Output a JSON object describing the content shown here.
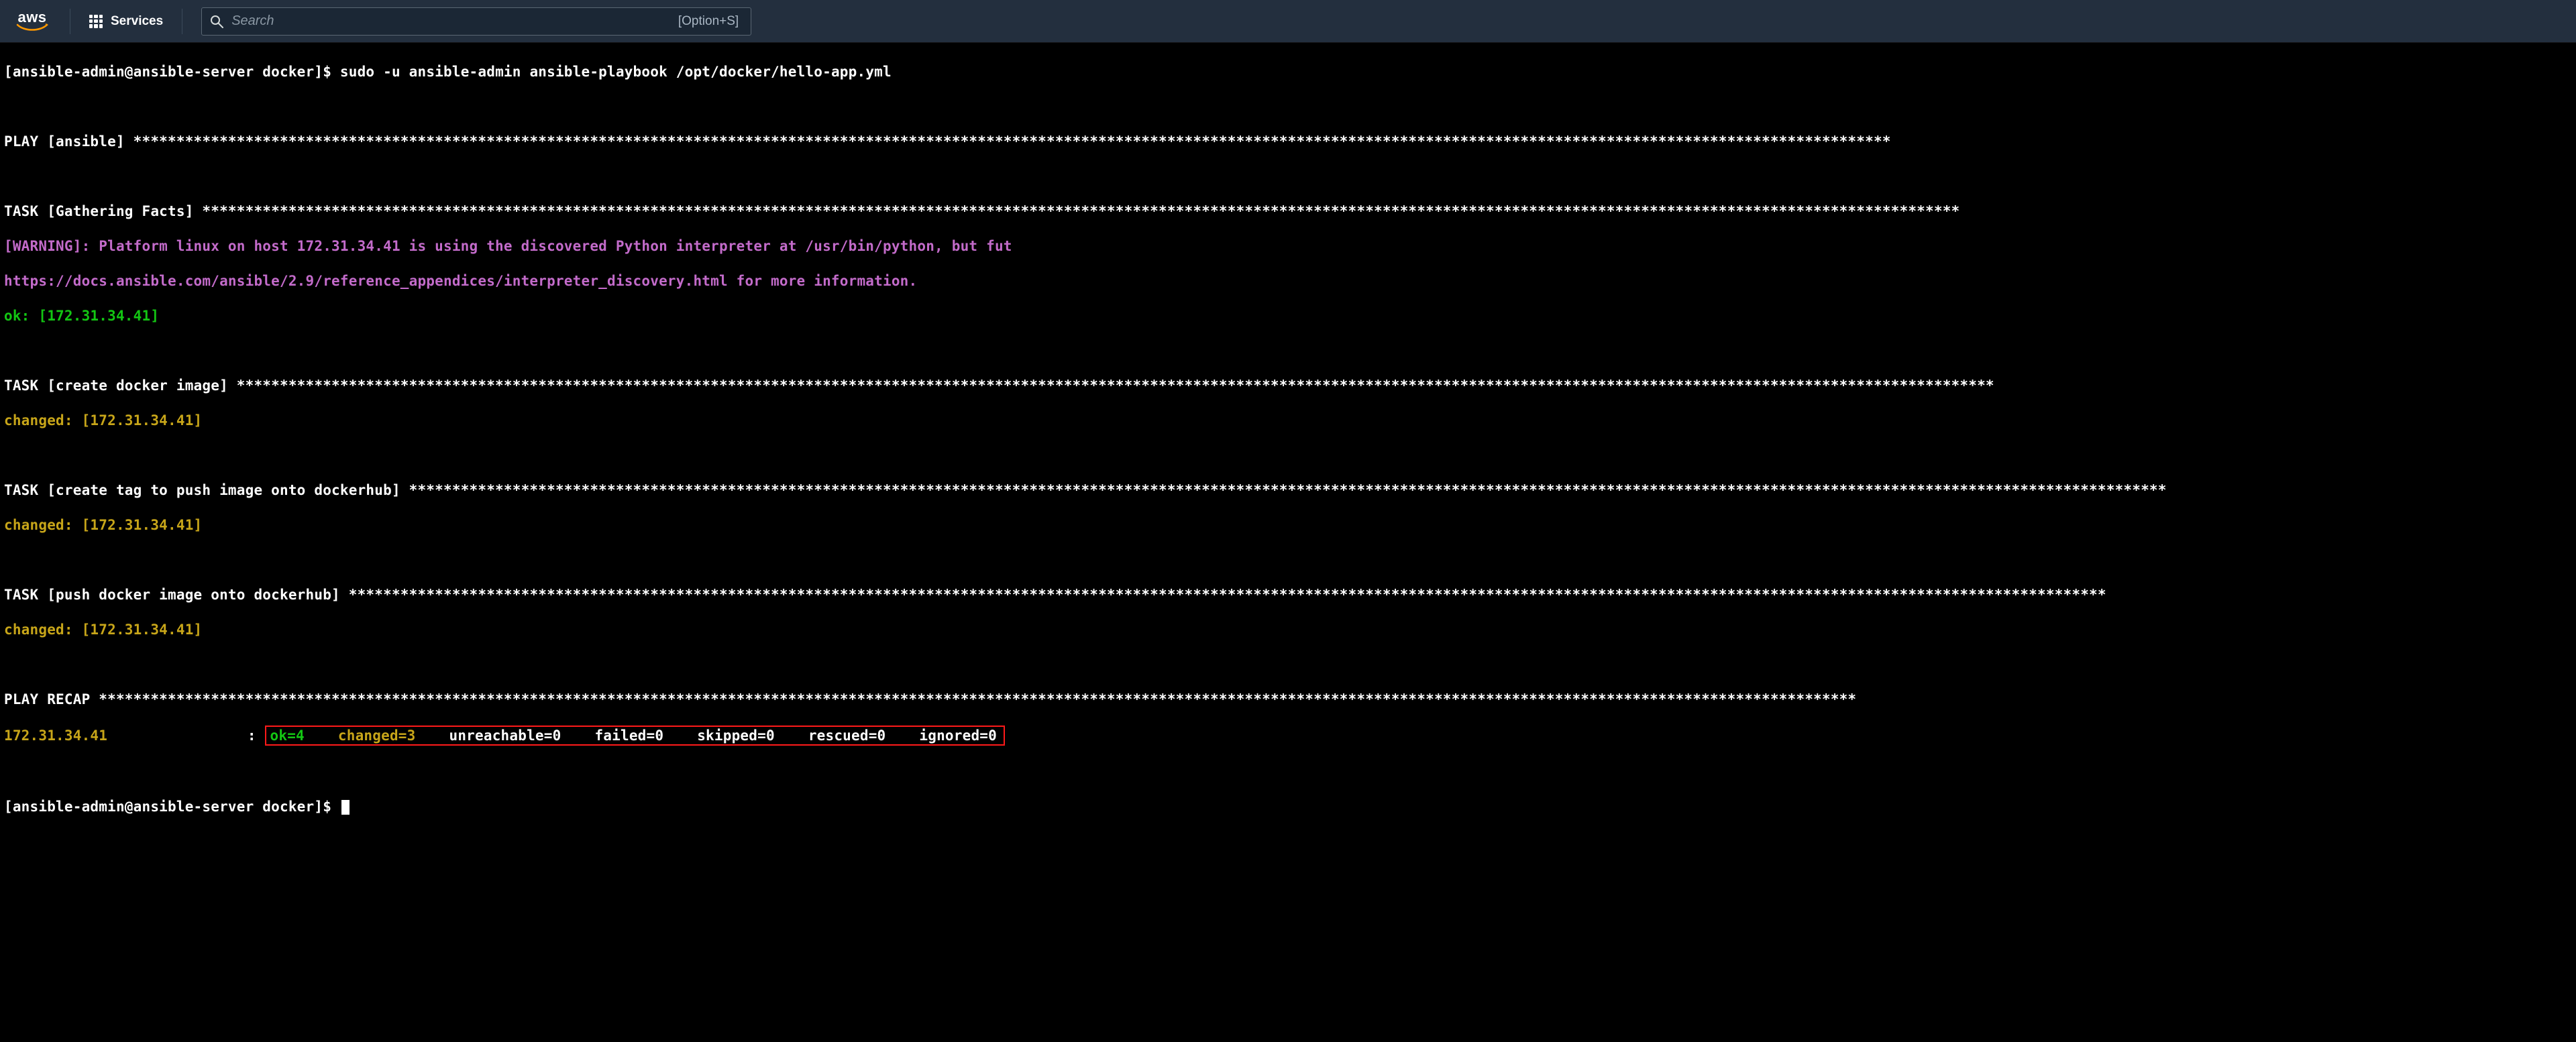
{
  "nav": {
    "logo_text": "aws",
    "services_label": "Services",
    "search_placeholder": "Search",
    "search_shortcut": "[Option+S]"
  },
  "term": {
    "prompt_user": "ansible-admin",
    "prompt_host": "ansible-server",
    "prompt_cwd": "docker",
    "prompt_rendered": "[ansible-admin@ansible-server docker]$ ",
    "command": "sudo -u ansible-admin ansible-playbook /opt/docker/hello-app.yml",
    "play_header_prefix": "PLAY [ansible] ",
    "task_gather_prefix": "TASK [Gathering Facts] ",
    "warning_line1": "[WARNING]: Platform linux on host 172.31.34.41 is using the discovered Python interpreter at /usr/bin/python, but fut",
    "warning_line2": "https://docs.ansible.com/ansible/2.9/reference_appendices/interpreter_discovery.html for more information.",
    "ok_line": "ok: [172.31.34.41]",
    "task_create_image_prefix": "TASK [create docker image] ",
    "changed_line": "changed: [172.31.34.41]",
    "task_create_tag_prefix": "TASK [create tag to push image onto dockerhub] ",
    "task_push_prefix": "TASK [push docker image onto dockerhub] ",
    "recap_prefix": "PLAY RECAP ",
    "recap_host": "172.31.34.41",
    "recap_colon": " : ",
    "recap": {
      "ok": "ok=4",
      "changed": "changed=3",
      "unreachable": "unreachable=0",
      "failed": "failed=0",
      "skipped": "skipped=0",
      "rescued": "rescued=0",
      "ignored": "ignored=0"
    },
    "host_ip": "172.31.34.41",
    "stars_long": "************************************************************************************************************************************************************************************************************"
  }
}
